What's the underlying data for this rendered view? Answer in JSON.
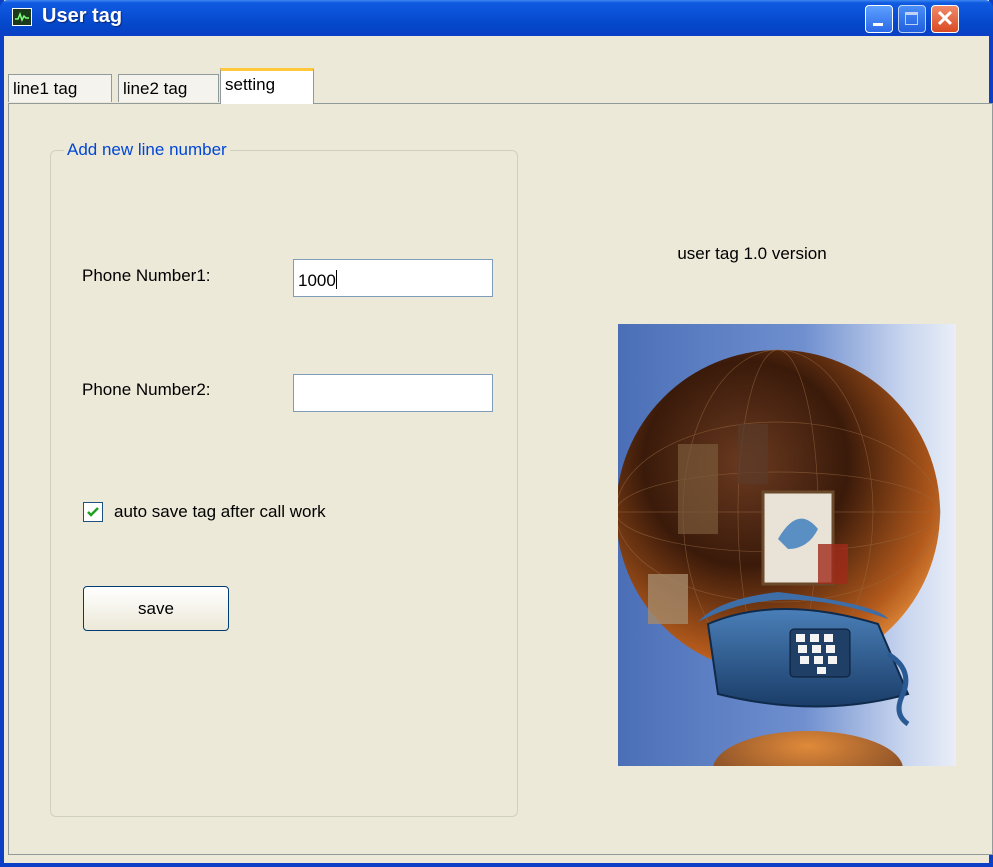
{
  "window": {
    "title": "User tag"
  },
  "tabs": [
    {
      "label": "line1 tag",
      "active": false
    },
    {
      "label": "line2 tag",
      "active": false
    },
    {
      "label": "setting",
      "active": true
    }
  ],
  "group": {
    "legend": "Add new line number"
  },
  "phone1": {
    "label": "Phone Number1:",
    "value": "1000"
  },
  "phone2": {
    "label": "Phone Number2:",
    "value": ""
  },
  "autosave": {
    "label": "auto save tag after call work",
    "checked": true
  },
  "save_button": {
    "label": "save"
  },
  "version_text": "user tag 1.0 version",
  "illustration": {
    "icon": "globe-telephone-illustration"
  },
  "colors": {
    "titlebar": "#0a50d8",
    "window_bg": "#ece9d8",
    "legend_text": "#0046d5",
    "active_tab_accent": "#ffc73c",
    "close_button": "#d94a22"
  }
}
